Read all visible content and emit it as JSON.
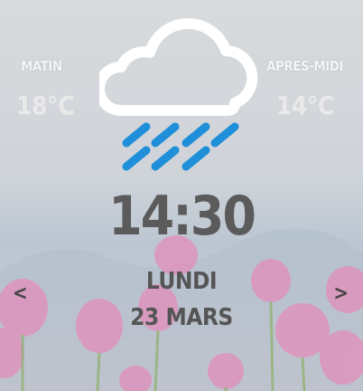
{
  "morning": {
    "label": "MATIN",
    "temp": "18°C"
  },
  "afternoon": {
    "label": "APRES-MIDI",
    "temp": "14°C"
  },
  "weather_icon": "cloud-rain-icon",
  "time": "14:30",
  "date": {
    "weekday": "LUNDI",
    "day": "23 MARS"
  },
  "nav": {
    "prev": "<",
    "next": ">"
  },
  "colors": {
    "rain": "#1e8fd8",
    "cloud": "#ffffff",
    "time": "#5b5b5b"
  }
}
